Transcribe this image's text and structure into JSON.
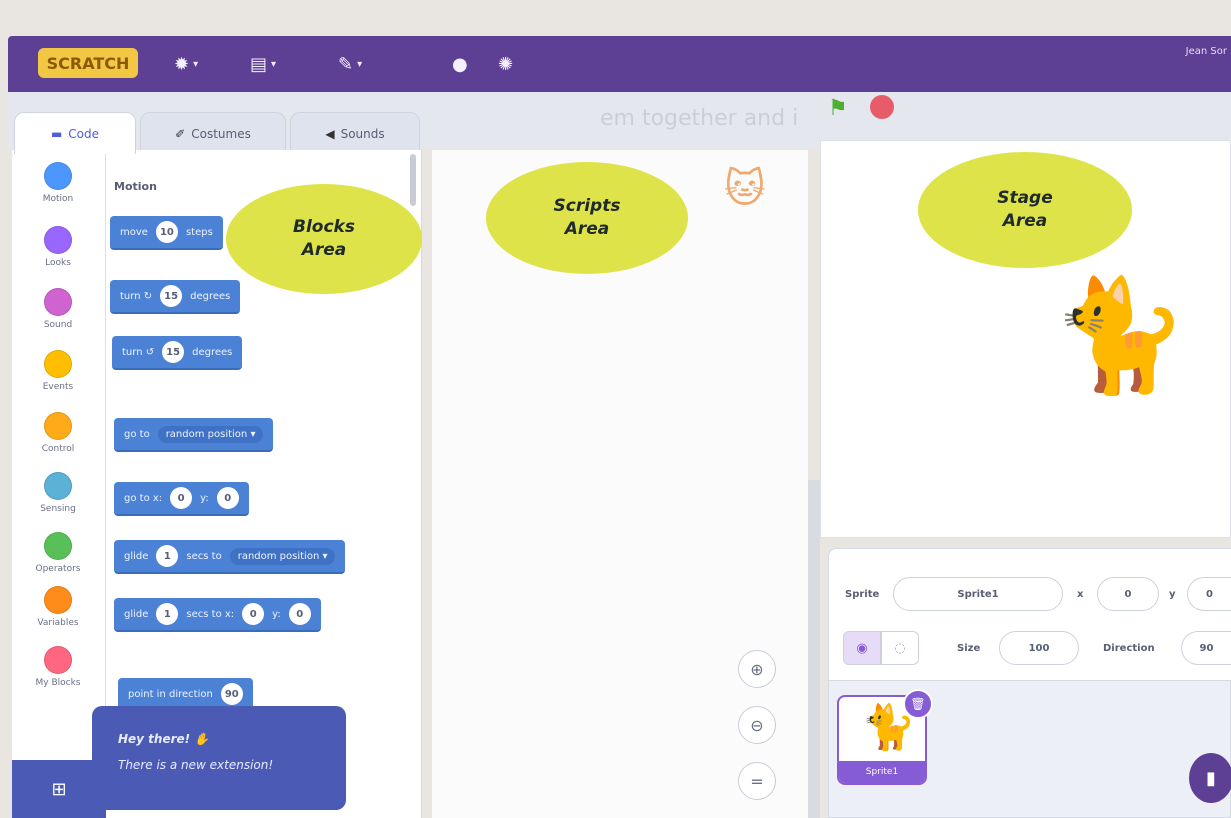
{
  "menubar": {
    "logo": "SCRATCH",
    "user": "Jean Sor"
  },
  "watermark": "em together and i",
  "tabs": [
    {
      "label": "Code",
      "icon": "code-icon"
    },
    {
      "label": "Costumes",
      "icon": "brush-icon"
    },
    {
      "label": "Sounds",
      "icon": "speaker-icon"
    }
  ],
  "categories": [
    {
      "label": "Motion",
      "color": "#4c97ff"
    },
    {
      "label": "Looks",
      "color": "#9966ff"
    },
    {
      "label": "Sound",
      "color": "#cf63cf"
    },
    {
      "label": "Events",
      "color": "#ffbf00"
    },
    {
      "label": "Control",
      "color": "#ffab19"
    },
    {
      "label": "Sensing",
      "color": "#5cb1d6"
    },
    {
      "label": "Operators",
      "color": "#59c059"
    },
    {
      "label": "Variables",
      "color": "#ff8c1a"
    },
    {
      "label": "My Blocks",
      "color": "#ff6680"
    }
  ],
  "palette": {
    "heading": "Motion",
    "blocks": {
      "move": {
        "text": "move",
        "value": "10",
        "suffix": "steps"
      },
      "turn_right": {
        "text": "turn ↻",
        "value": "15",
        "suffix": "degrees"
      },
      "turn_left": {
        "text": "turn ↺",
        "value": "15",
        "suffix": "degrees"
      },
      "go_to": {
        "text": "go to",
        "option": "random position ▾"
      },
      "go_to_xy": {
        "text": "go to x:",
        "x": "0",
        "ylabel": "y:",
        "y": "0"
      },
      "glide_to": {
        "text": "glide",
        "value": "1",
        "mid": "secs to",
        "option": "random position ▾"
      },
      "glide_xy": {
        "text": "glide",
        "value": "1",
        "mid": "secs to x:",
        "x": "0",
        "ylabel": "y:",
        "y": "0"
      },
      "point": {
        "text": "point in direction",
        "value": "90"
      }
    }
  },
  "callouts": {
    "blocks": [
      "Blocks",
      "Area"
    ],
    "scripts": [
      "Scripts",
      "Area"
    ],
    "stage": [
      "Stage",
      "Area"
    ]
  },
  "sprite_info": {
    "sprite_label": "Sprite",
    "sprite_name": "Sprite1",
    "x_label": "x",
    "x_value": "0",
    "y_label": "y",
    "y_value": "0",
    "size_label": "Size",
    "size_value": "100",
    "direction_label": "Direction",
    "direction_value": "90"
  },
  "sprite_thumb": {
    "label": "Sprite1"
  },
  "toast": {
    "line1": "Hey there!",
    "line2": "There is a new extension!"
  },
  "zoom": {
    "in": "+",
    "out": "−",
    "reset": "="
  },
  "accent": {
    "purple": "#5d3f93",
    "block_blue": "#4c82d6",
    "callout_yellow": "#dfe34a"
  }
}
